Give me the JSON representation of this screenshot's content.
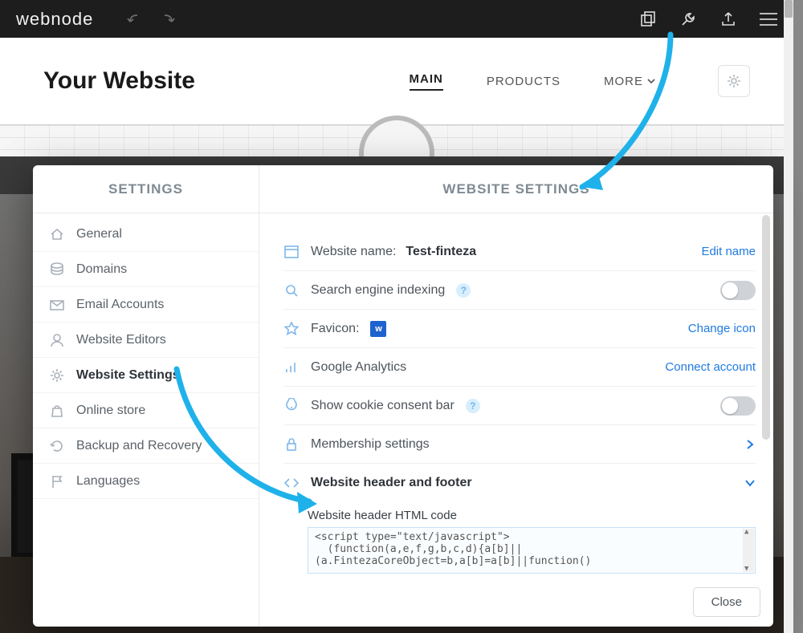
{
  "topbar": {
    "brand": "webnode"
  },
  "site": {
    "title": "Your Website",
    "nav_main": "MAIN",
    "nav_products": "PRODUCTS",
    "nav_more": "MORE"
  },
  "modal": {
    "sidebar_title": "SETTINGS",
    "panel_title": "WEBSITE SETTINGS",
    "close": "Close"
  },
  "sidebar": {
    "items": [
      {
        "label": "General"
      },
      {
        "label": "Domains"
      },
      {
        "label": "Email Accounts"
      },
      {
        "label": "Website Editors"
      },
      {
        "label": "Website Settings"
      },
      {
        "label": "Online store"
      },
      {
        "label": "Backup and Recovery"
      },
      {
        "label": "Languages"
      }
    ]
  },
  "panel": {
    "name_label": "Website name: ",
    "name_value": "Test-finteza",
    "edit_name": "Edit name",
    "search_indexing": "Search engine indexing",
    "favicon_label": "Favicon:",
    "favicon_badge": "w",
    "change_icon": "Change icon",
    "google_analytics": "Google Analytics",
    "connect_account": "Connect account",
    "cookie_bar": "Show cookie consent bar",
    "membership": "Membership settings",
    "header_footer": "Website header and footer",
    "header_html_label": "Website header HTML code",
    "header_html_code": "<script type=\"text/javascript\">\n  (function(a,e,f,g,b,c,d){a[b]||\n(a.FintezaCoreObject=b,a[b]=a[b]||function()"
  }
}
